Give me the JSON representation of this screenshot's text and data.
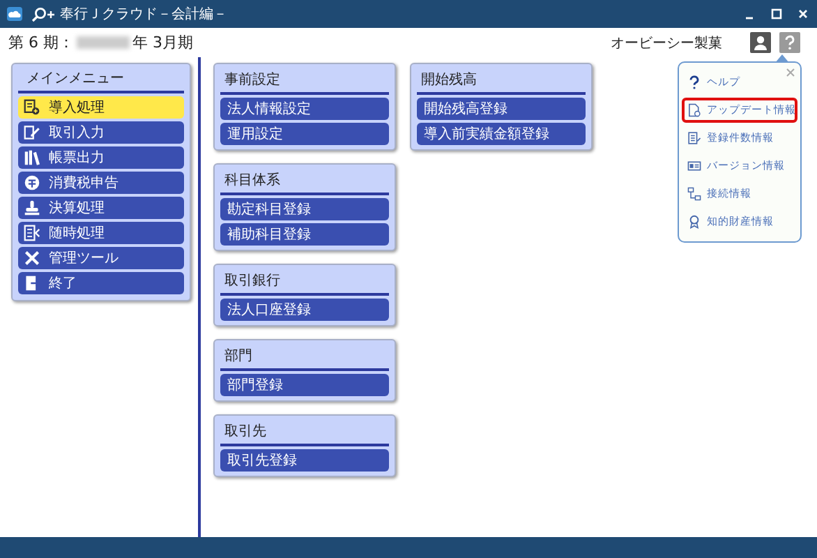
{
  "window": {
    "title": "奉行Ｊクラウド－会計編－"
  },
  "header": {
    "period_prefix": "第 6 期：",
    "period_suffix": "年 3月期",
    "company": "オービーシー製菓"
  },
  "main_menu": {
    "title": "メインメニュー",
    "items": [
      {
        "label": "導入処理",
        "selected": true
      },
      {
        "label": "取引入力",
        "selected": false
      },
      {
        "label": "帳票出力",
        "selected": false
      },
      {
        "label": "消費税申告",
        "selected": false
      },
      {
        "label": "決算処理",
        "selected": false
      },
      {
        "label": "随時処理",
        "selected": false
      },
      {
        "label": "管理ツール",
        "selected": false
      },
      {
        "label": "終了",
        "selected": false
      }
    ]
  },
  "columns": [
    {
      "groups": [
        {
          "title": "事前設定",
          "buttons": [
            "法人情報設定",
            "運用設定"
          ]
        },
        {
          "title": "科目体系",
          "buttons": [
            "勘定科目登録",
            "補助科目登録"
          ]
        },
        {
          "title": "取引銀行",
          "buttons": [
            "法人口座登録"
          ]
        },
        {
          "title": "部門",
          "buttons": [
            "部門登録"
          ]
        },
        {
          "title": "取引先",
          "buttons": [
            "取引先登録"
          ]
        }
      ]
    },
    {
      "groups": [
        {
          "title": "開始残高",
          "buttons": [
            "開始残高登録",
            "導入前実績金額登録"
          ]
        }
      ]
    }
  ],
  "help_popup": {
    "items": [
      {
        "label": "ヘルプ",
        "selected": false
      },
      {
        "label": "アップデート情報",
        "selected": true
      },
      {
        "label": "登録件数情報",
        "selected": false
      },
      {
        "label": "バージョン情報",
        "selected": false
      },
      {
        "label": "接続情報",
        "selected": false
      },
      {
        "label": "知的財産情報",
        "selected": false
      }
    ]
  }
}
